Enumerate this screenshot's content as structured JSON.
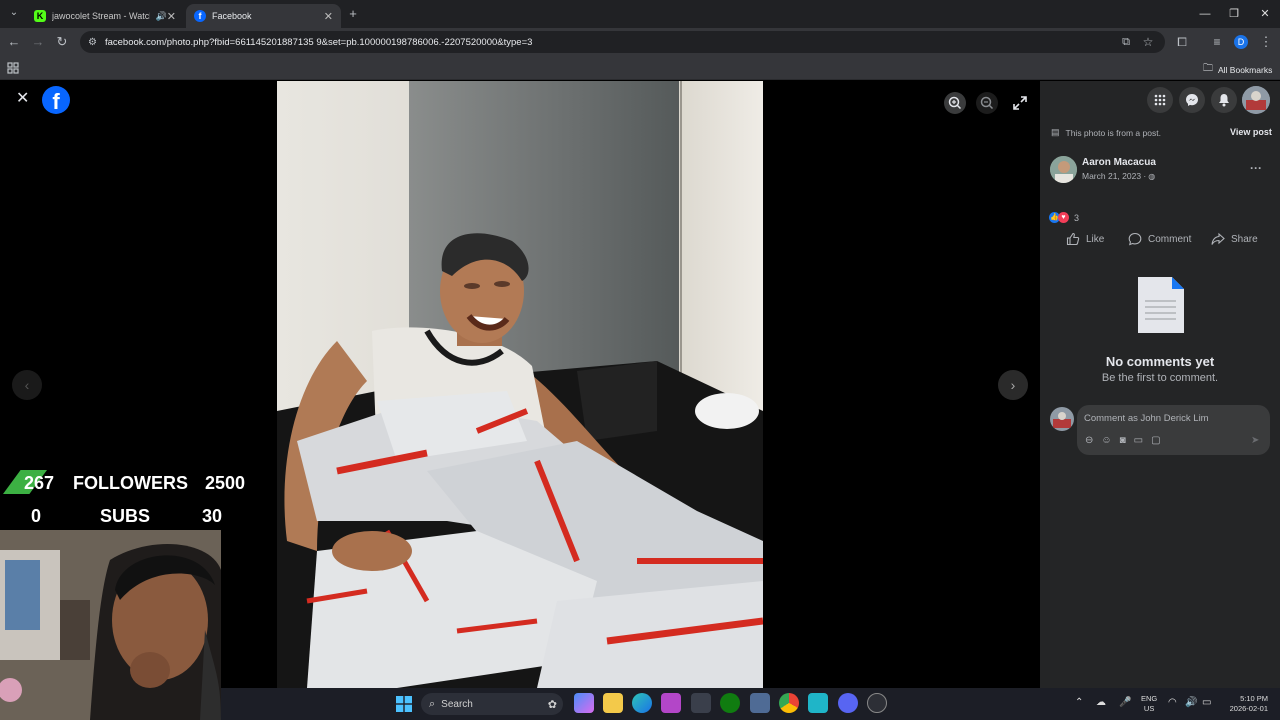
{
  "browser": {
    "tabs": [
      {
        "title": "jawocolet Stream - Watch L",
        "active": false
      },
      {
        "title": "Facebook",
        "active": true
      }
    ],
    "url": "facebook.com/photo.php?fbid=661145201887135 9&set=pb.100000198786006.-2207520000&type=3",
    "bookmarks_label": "All Bookmarks",
    "profile_initial": "D"
  },
  "viewer": {
    "logo": "f"
  },
  "post": {
    "from_post_text": "This photo is from a post.",
    "view_post": "View post",
    "author": "Aaron Macacua",
    "date": "March 21, 2023 · ",
    "reaction_count": "3",
    "like": "Like",
    "comment": "Comment",
    "share": "Share",
    "no_comments_title": "No comments yet",
    "no_comments_sub": "Be the first to comment.",
    "comment_placeholder": "Comment as John Derick Lim",
    "more": "···"
  },
  "stream_overlay": {
    "followers_count": "267",
    "followers_label": "FOLLOWERS",
    "followers_goal": "2500",
    "subs_count": "0",
    "subs_label": "SUBS",
    "subs_goal": "30"
  },
  "taskbar": {
    "search_label": "Search",
    "lang_line1": "ENG",
    "lang_line2": "US",
    "time": "5:10 PM",
    "date": "2026-02-01"
  },
  "colors": {
    "fb_blue": "#0866ff",
    "sidebar_bg": "#242526",
    "overlay_green": "#3cb043"
  }
}
